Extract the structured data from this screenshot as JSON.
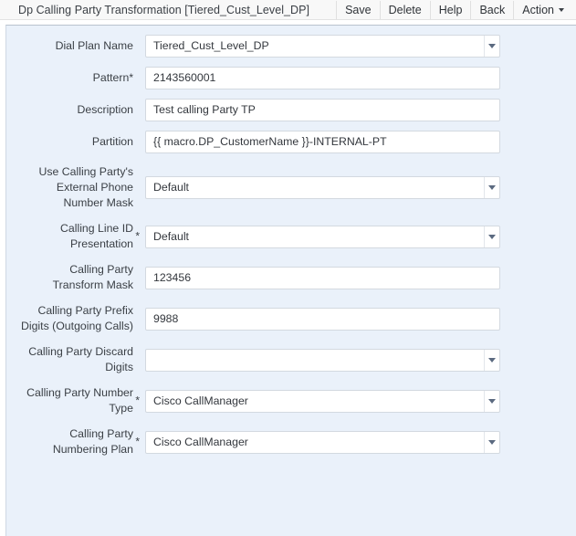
{
  "header": {
    "title": "Dp Calling Party Transformation [Tiered_Cust_Level_DP]",
    "actions": [
      {
        "label": "Save",
        "name": "save-button"
      },
      {
        "label": "Delete",
        "name": "delete-button"
      },
      {
        "label": "Help",
        "name": "help-button"
      },
      {
        "label": "Back",
        "name": "back-button"
      },
      {
        "label": "Action",
        "name": "action-menu-button",
        "has_caret": true
      }
    ]
  },
  "form": {
    "required_marker": "*",
    "fields": [
      {
        "label": "Dial Plan Name",
        "value": "Tiered_Cust_Level_DP",
        "type": "select",
        "required": false
      },
      {
        "label": "Pattern",
        "value": "2143560001",
        "type": "text",
        "required": true,
        "required_inline": true
      },
      {
        "label": "Description",
        "value": "Test calling Party TP",
        "type": "text",
        "required": false
      },
      {
        "label": "Partition",
        "value": "{{ macro.DP_CustomerName }}-INTERNAL-PT",
        "type": "text",
        "required": false
      },
      {
        "label": "Use Calling Party's\nExternal Phone\nNumber Mask",
        "value": "Default",
        "type": "select",
        "required": false
      },
      {
        "label": "Calling Line ID\nPresentation",
        "value": "Default",
        "type": "select",
        "required": true
      },
      {
        "label": "Calling Party\nTransform Mask",
        "value": "123456",
        "type": "text",
        "required": false
      },
      {
        "label": "Calling Party Prefix\nDigits (Outgoing Calls)",
        "value": "9988",
        "type": "text",
        "required": false
      },
      {
        "label": "Calling Party Discard\nDigits",
        "value": "",
        "type": "select",
        "required": false
      },
      {
        "label": "Calling Party Number\nType",
        "value": "Cisco CallManager",
        "type": "select",
        "required": true
      },
      {
        "label": "Calling Party\nNumbering Plan",
        "value": "Cisco CallManager",
        "type": "select",
        "required": true
      }
    ]
  },
  "colors": {
    "panel_background": "#eaf1fa",
    "header_background": "#f8f8f8",
    "field_border": "#d3d9e0",
    "text": "#33373d",
    "arrow": "#5b6a80"
  }
}
